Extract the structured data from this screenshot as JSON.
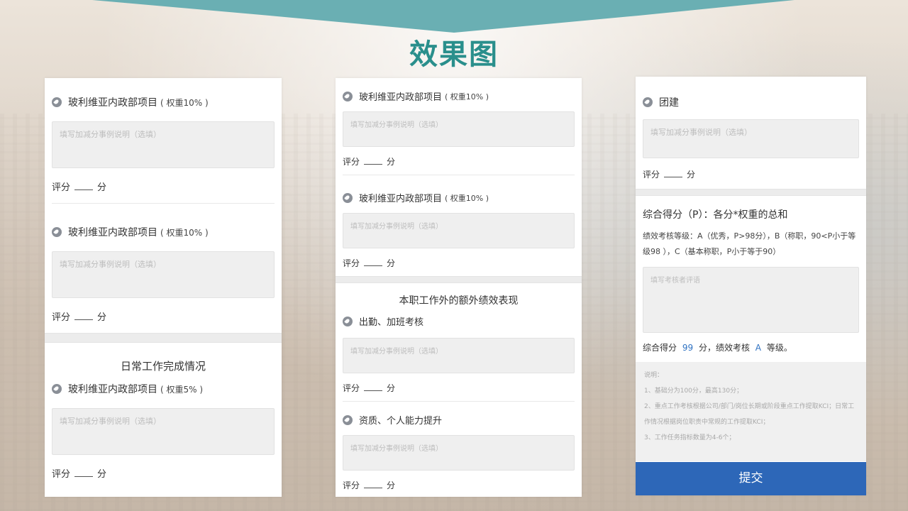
{
  "page": {
    "title": "效果图"
  },
  "common": {
    "textarea_placeholder": "填写加减分事例说明（选填）",
    "score_prefix": "评分",
    "score_suffix": "分"
  },
  "col1": {
    "item1": {
      "label": "玻利维亚内政部项目",
      "weight": "( 权重10% )"
    },
    "item2": {
      "label": "玻利维亚内政部项目",
      "weight": "( 权重10% )"
    },
    "section_title": "日常工作完成情况",
    "item3": {
      "label": "玻利维亚内政部项目",
      "weight": "( 权重5% )"
    }
  },
  "col2": {
    "item1": {
      "label": "玻利维亚内政部项目",
      "weight": "( 权重10% )"
    },
    "item2": {
      "label": "玻利维亚内政部项目",
      "weight": "( 权重10% )"
    },
    "section_title": "本职工作外的额外绩效表现",
    "item3": {
      "label": "出勤、加班考核"
    },
    "item4": {
      "label": "资质、个人能力提升"
    }
  },
  "col3": {
    "item1": {
      "label": "团建"
    },
    "summary_title": "综合得分（P）：各分*权重的总和",
    "grade_desc": "绩效考核等级：A（优秀，P>98分），B（称职，90<P小于等级98 ），C（基本称职，P小于等于90）",
    "comment_placeholder": "填写考核者评语",
    "result_prefix": "综合得分",
    "result_score": "99",
    "result_mid": "分，绩效考核",
    "result_grade": "A",
    "result_suffix": "等级。",
    "notes": [
      "说明：",
      "1、基础分为100分，最高130分；",
      "2、重点工作考核根据公司/部门/岗位长期或阶段重点工作提取KCI；日常工作情况根据岗位职责中常规的工作提取KCI；",
      "3、工作任务指标数量为4-6个；"
    ],
    "submit_label": "提交"
  },
  "colors": {
    "banner": "#6aafb3",
    "title": "#2a8f8c",
    "submit": "#2d67b8",
    "accent_blue": "#2f72c2"
  }
}
